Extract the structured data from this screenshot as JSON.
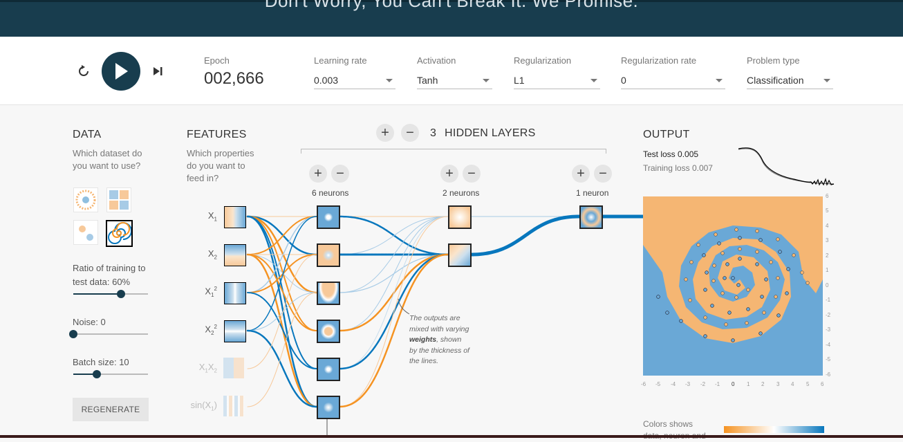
{
  "header": {
    "tagline": "Don't Worry, You Can't Break It. We Promise."
  },
  "controls": {
    "epoch_label": "Epoch",
    "epoch_value": "002,666",
    "learning_rate": {
      "label": "Learning rate",
      "value": "0.003"
    },
    "activation": {
      "label": "Activation",
      "value": "Tanh"
    },
    "regularization": {
      "label": "Regularization",
      "value": "L1"
    },
    "regularization_rate": {
      "label": "Regularization rate",
      "value": "0"
    },
    "problem_type": {
      "label": "Problem type",
      "value": "Classification"
    }
  },
  "data_panel": {
    "title": "DATA",
    "question_line1": "Which dataset do",
    "question_line2": "you want to use?",
    "ratio_label_line1": "Ratio of training to",
    "ratio_label_line2": "test data:  60%",
    "ratio_value": 0.6,
    "noise_label": "Noise:  0",
    "noise_value": 0,
    "batch_label": "Batch size:  10",
    "batch_value": 10,
    "regenerate": "REGENERATE"
  },
  "features_panel": {
    "title": "FEATURES",
    "question_line1": "Which properties",
    "question_line2": "do you want to",
    "question_line3": "feed in?",
    "features": [
      "X1",
      "X2",
      "X1²",
      "X2²",
      "X1X2",
      "sin(X1)"
    ]
  },
  "network": {
    "hidden_layers_count": "3",
    "hidden_layers_label": "HIDDEN LAYERS",
    "layer1_label": "6 neurons",
    "layer2_label": "2 neurons",
    "layer3_label": "1 neuron",
    "note_line1": "The outputs are",
    "note_line2": "mixed with varying",
    "note_bold": "weights",
    "note_line3": ", shown",
    "note_line4": "by the thickness of",
    "note_line5": "the lines.",
    "plus": "+",
    "minus": "−"
  },
  "output_panel": {
    "title": "OUTPUT",
    "test_loss_label": "Test loss",
    "test_loss": "0.005",
    "training_loss_label": "Training loss",
    "training_loss": "0.007",
    "y_ticks": [
      "6",
      "5",
      "4",
      "3",
      "2",
      "1",
      "0",
      "-1",
      "-2",
      "-3",
      "-4",
      "-5",
      "-6"
    ],
    "x_ticks": [
      "-6",
      "-5",
      "-4",
      "-3",
      "-2",
      "-1",
      "0",
      "1",
      "2",
      "3",
      "4",
      "5",
      "6"
    ],
    "colors_line1": "Colors shows",
    "colors_line2": "data, neuron and"
  },
  "colors": {
    "orange": "#f59322",
    "blue": "#0877bd",
    "dark": "#183d4e"
  }
}
